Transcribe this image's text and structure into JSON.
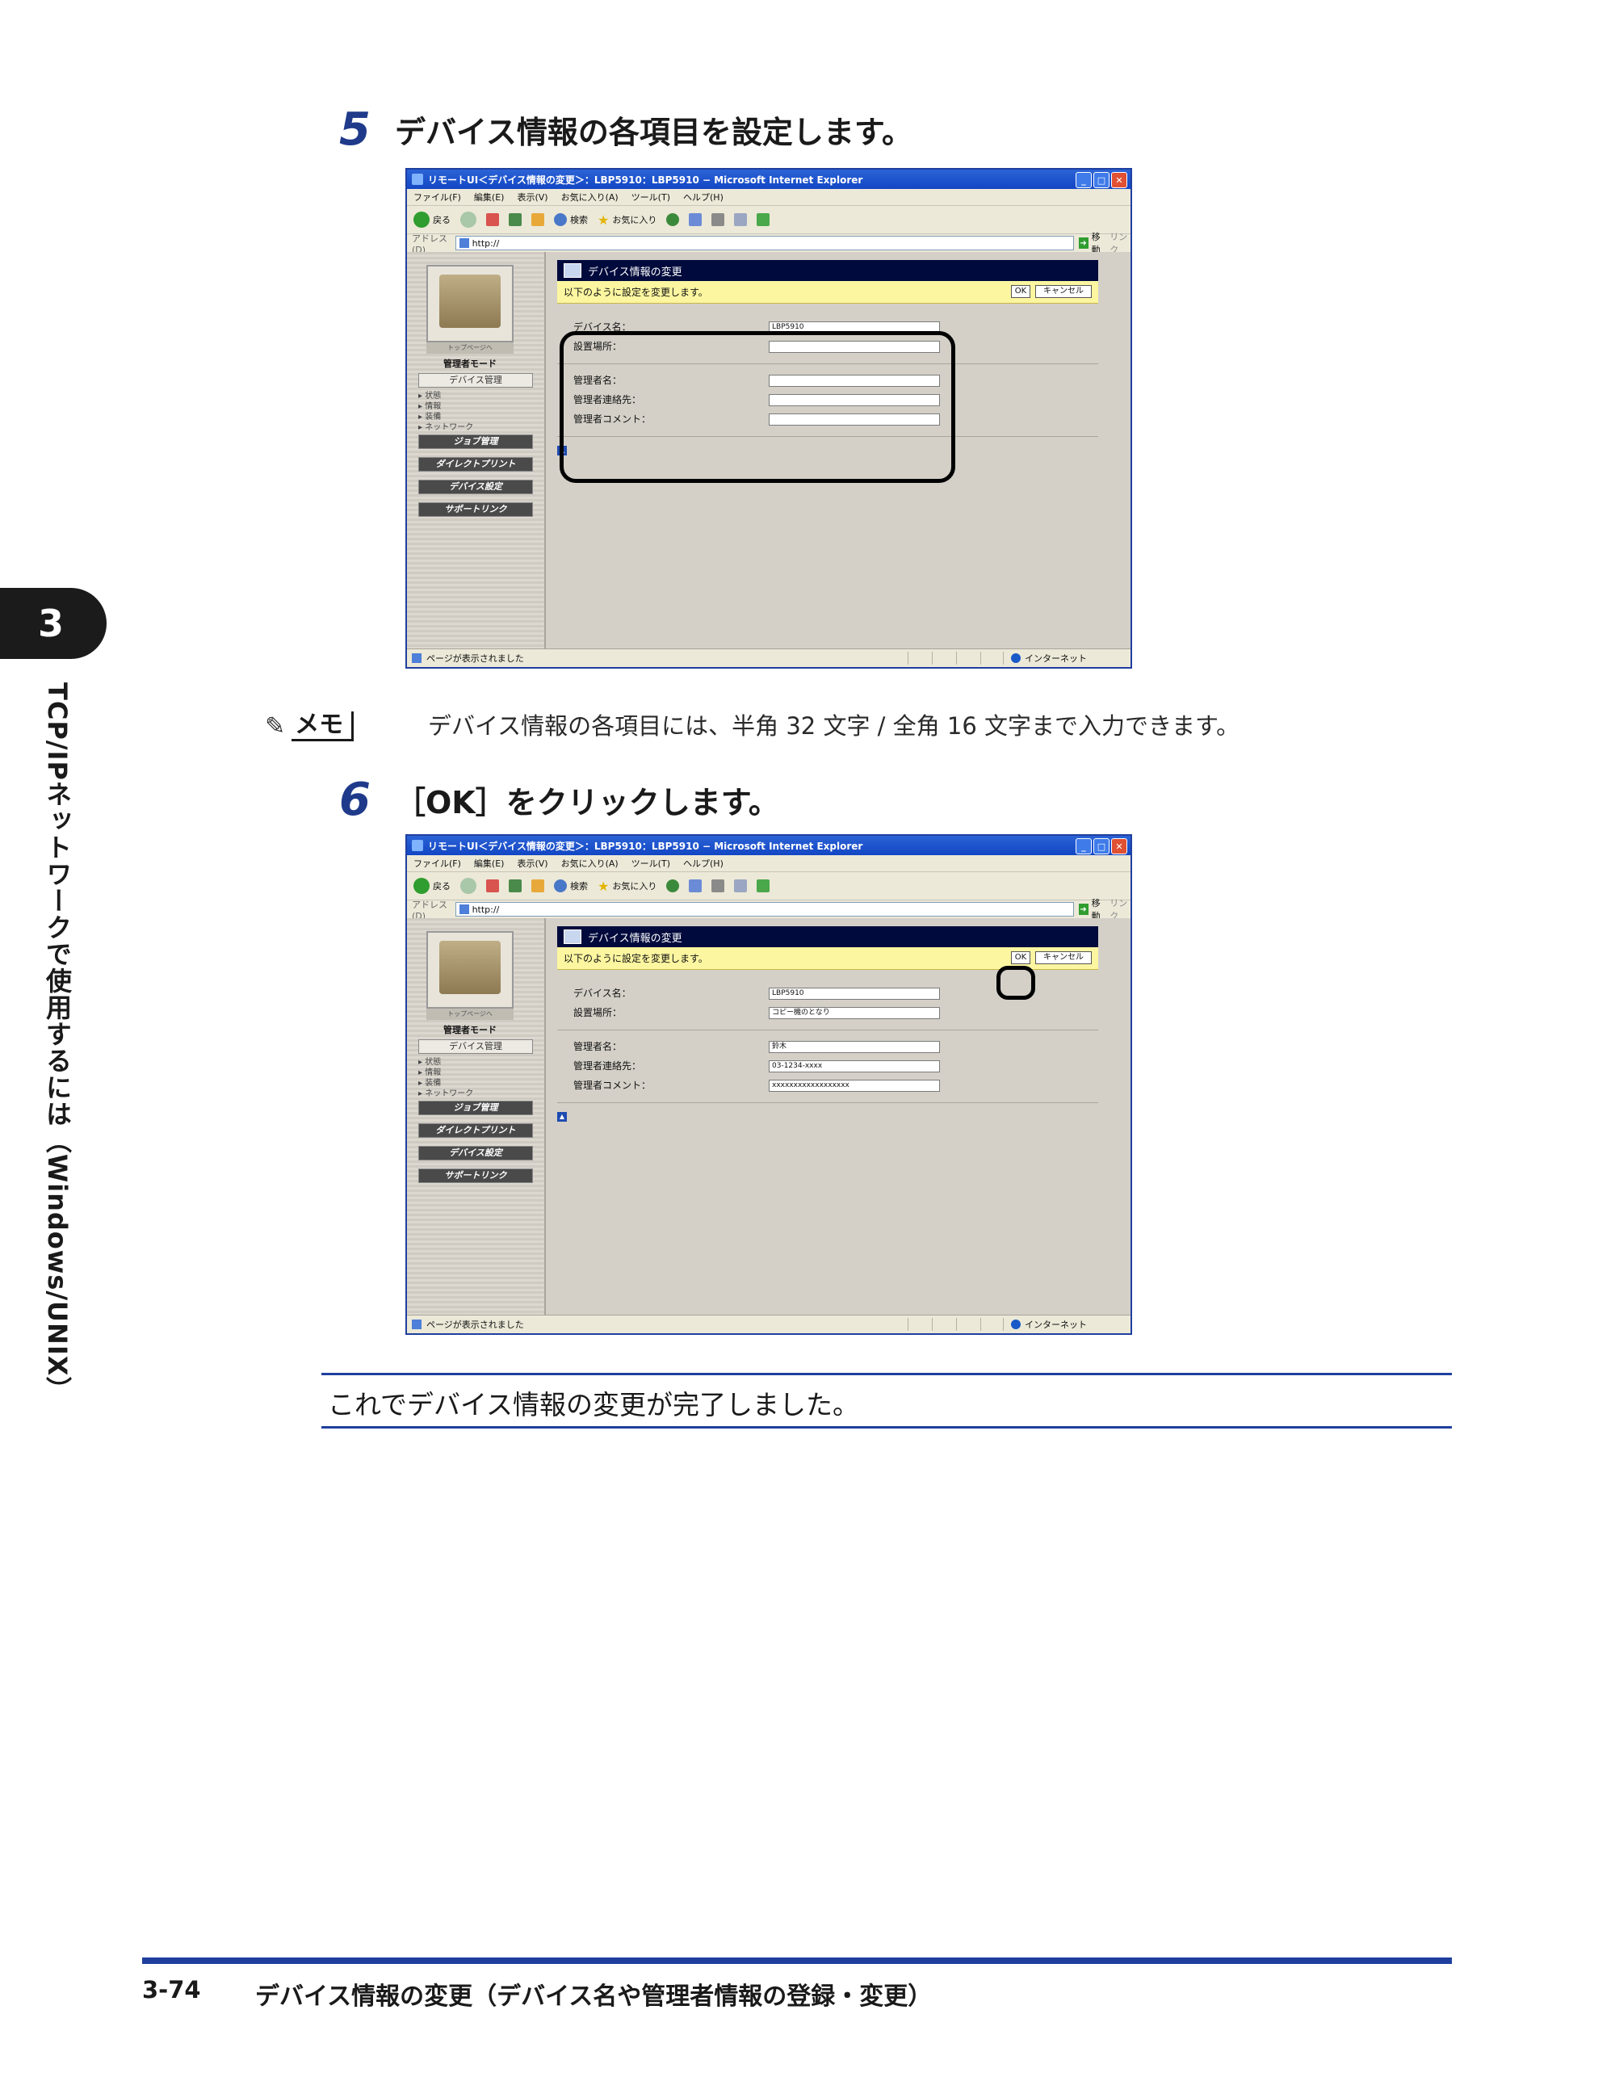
{
  "chapter": {
    "number": "3",
    "title": "TCP/IPネットワークで使用するには（Windows/UNIX）"
  },
  "steps": [
    {
      "number": "5",
      "text": "デバイス情報の各項目を設定します。"
    },
    {
      "number": "6",
      "text": "［OK］をクリックします。"
    }
  ],
  "memo": {
    "label": "メモ",
    "text": "デバイス情報の各項目には、半角 32 文字 / 全角 16 文字まで入力できます。"
  },
  "browser": {
    "window_title": "リモートUI＜デバイス情報の変更＞：LBP5910：LBP5910 − Microsoft Internet Explorer",
    "menu": [
      "ファイル(F)",
      "編集(E)",
      "表示(V)",
      "お気に入り(A)",
      "ツール(T)",
      "ヘルプ(H)"
    ],
    "toolbar": {
      "back": "戻る",
      "search": "検索",
      "favorites": "お気に入り"
    },
    "address": {
      "label": "アドレス(D)",
      "url": "http://",
      "go": "移動",
      "links": "リンク"
    },
    "status": {
      "left": "ページが表示されました",
      "zone": "インターネット"
    },
    "nav": {
      "logo_caption": "トップページへ",
      "mode": "管理者モード",
      "device_mgmt": "デバイス管理",
      "sub_items": [
        "状態",
        "情報",
        "装備",
        "ネットワーク"
      ],
      "buttons": [
        "ジョブ管理",
        "ダイレクトプリント",
        "デバイス設定",
        "サポートリンク"
      ]
    },
    "panel": {
      "title": "デバイス情報の変更",
      "instruction": "以下のように設定を変更します。",
      "ok": "OK",
      "cancel": "キャンセル",
      "labels": [
        "デバイス名：",
        "設置場所：",
        "管理者名：",
        "管理者連絡先：",
        "管理者コメント："
      ]
    }
  },
  "screens": [
    {
      "values": [
        "LBP5910",
        "",
        "",
        "",
        ""
      ]
    },
    {
      "values": [
        "LBP5910",
        "コピー機のとなり",
        "鈴木",
        "03-1234-xxxx",
        "xxxxxxxxxxxxxxxxxx"
      ]
    }
  ],
  "conclusion": "これでデバイス情報の変更が完了しました。",
  "footer": {
    "page": "3-74",
    "title": "デバイス情報の変更（デバイス名や管理者情報の登録・変更）"
  },
  "colors": {
    "accent": "#1f3f9f",
    "step_number": "#1f3a8a",
    "panel_header": "#000a3c",
    "panel_highlight": "#fcf6a0"
  }
}
